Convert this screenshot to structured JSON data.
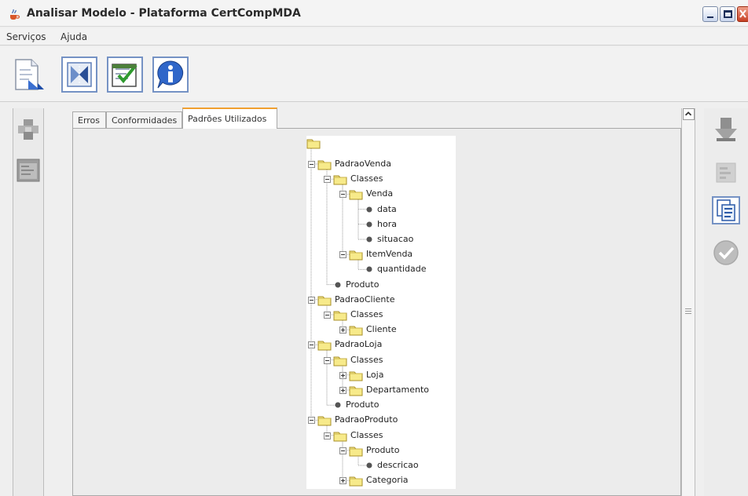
{
  "window": {
    "title": "Analisar Modelo - Plataforma CertCompMDA",
    "app_icon": "java-cup-icon",
    "controls": [
      "minimize-icon",
      "maximize-icon",
      "close-icon"
    ]
  },
  "menu": {
    "items": [
      {
        "label": "Serviços"
      },
      {
        "label": "Ajuda"
      }
    ]
  },
  "toolbar": {
    "buttons": [
      {
        "icon": "document-icon"
      },
      {
        "icon": "transform-icon"
      },
      {
        "icon": "validate-icon"
      },
      {
        "icon": "info-icon"
      }
    ]
  },
  "left_panel": {
    "buttons": [
      {
        "icon": "component-icon"
      },
      {
        "icon": "model-window-icon"
      }
    ]
  },
  "tabs": [
    {
      "label": "Erros",
      "active": false
    },
    {
      "label": "Conformidades",
      "active": false
    },
    {
      "label": "Padrões Utilizados",
      "active": true
    }
  ],
  "tree": {
    "root_label": "",
    "nodes": [
      {
        "label": "PadraoVenda",
        "kind": "folder"
      },
      {
        "label": "Classes",
        "kind": "folder"
      },
      {
        "label": "Venda",
        "kind": "folder"
      },
      {
        "label": "data",
        "kind": "leaf"
      },
      {
        "label": "hora",
        "kind": "leaf"
      },
      {
        "label": "situacao",
        "kind": "leaf"
      },
      {
        "label": "ItemVenda",
        "kind": "folder"
      },
      {
        "label": "quantidade",
        "kind": "leaf"
      },
      {
        "label": "Produto",
        "kind": "leaf"
      },
      {
        "label": "PadraoCliente",
        "kind": "folder"
      },
      {
        "label": "Classes",
        "kind": "folder"
      },
      {
        "label": "Cliente",
        "kind": "folder",
        "collapsed": true
      },
      {
        "label": "PadraoLoja",
        "kind": "folder"
      },
      {
        "label": "Classes",
        "kind": "folder"
      },
      {
        "label": "Loja",
        "kind": "folder",
        "collapsed": true
      },
      {
        "label": "Departamento",
        "kind": "folder",
        "collapsed": true
      },
      {
        "label": "Produto",
        "kind": "leaf"
      },
      {
        "label": "PadraoProduto",
        "kind": "folder"
      },
      {
        "label": "Classes",
        "kind": "folder"
      },
      {
        "label": "Produto",
        "kind": "folder"
      },
      {
        "label": "descricao",
        "kind": "leaf"
      },
      {
        "label": "Categoria",
        "kind": "folder",
        "collapsed": true
      }
    ]
  },
  "right_panel": {
    "buttons": [
      {
        "icon": "download-icon"
      },
      {
        "icon": "export-icon"
      },
      {
        "icon": "copy-icon"
      },
      {
        "icon": "check-icon"
      }
    ]
  },
  "colors": {
    "folder": "#f7ea8a",
    "tab_accent": "#f0a030",
    "button_border": "#7592c4"
  }
}
